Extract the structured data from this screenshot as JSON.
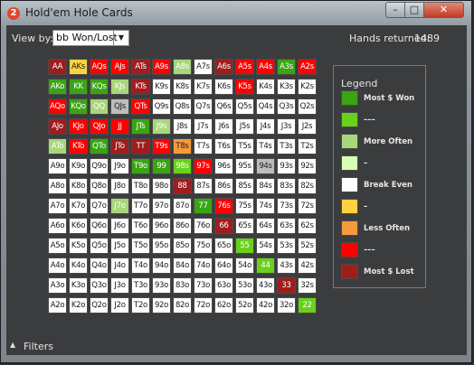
{
  "window": {
    "title": "Hold'em Hole Cards",
    "app_icon": "2",
    "controls": {
      "minimize": "–",
      "maximize": "□",
      "close": "✕"
    }
  },
  "toolbar": {
    "view_by_label": "View by:",
    "view_by_value": "bb Won/Lost",
    "dropdown_icon": "▼",
    "hands_label": "Hands returned:",
    "hands_value": "1489"
  },
  "colors": {
    "dark_red": "#9f1d1d",
    "red": "#ff0000",
    "orange": "#f79a3b",
    "yellow": "#ffd23f",
    "white": "#ffffff",
    "pale_green": "#d9ffb0",
    "light_green": "#a8d67a",
    "green": "#6ad11a",
    "dark_green": "#39a512",
    "gray": "#bdbdbd"
  },
  "grid": {
    "rows": [
      [
        "AA",
        "AKs",
        "AQs",
        "AJs",
        "ATs",
        "A9s",
        "A8s",
        "A7s",
        "A6s",
        "A5s",
        "A4s",
        "A3s",
        "A2s"
      ],
      [
        "AKo",
        "KK",
        "KQs",
        "KJs",
        "KTs",
        "K9s",
        "K8s",
        "K7s",
        "K6s",
        "K5s",
        "K4s",
        "K3s",
        "K2s"
      ],
      [
        "AQo",
        "KQo",
        "QQ",
        "QJs",
        "QTs",
        "Q9s",
        "Q8s",
        "Q7s",
        "Q6s",
        "Q5s",
        "Q4s",
        "Q3s",
        "Q2s"
      ],
      [
        "AJo",
        "KJo",
        "QJo",
        "JJ",
        "JTs",
        "J9s",
        "J8s",
        "J7s",
        "J6s",
        "J5s",
        "J4s",
        "J3s",
        "J2s"
      ],
      [
        "ATo",
        "KTo",
        "QTo",
        "JTo",
        "TT",
        "T9s",
        "T8s",
        "T7s",
        "T6s",
        "T5s",
        "T4s",
        "T3s",
        "T2s"
      ],
      [
        "A9o",
        "K9o",
        "Q9o",
        "J9o",
        "T9o",
        "99",
        "98s",
        "97s",
        "96s",
        "95s",
        "94s",
        "93s",
        "92s"
      ],
      [
        "A8o",
        "K8o",
        "Q8o",
        "J8o",
        "T8o",
        "98o",
        "88",
        "87s",
        "86s",
        "85s",
        "84s",
        "83s",
        "82s"
      ],
      [
        "A7o",
        "K7o",
        "Q7o",
        "J7o",
        "T7o",
        "97o",
        "87o",
        "77",
        "76s",
        "75s",
        "74s",
        "73s",
        "72s"
      ],
      [
        "A6o",
        "K6o",
        "Q6o",
        "J6o",
        "T6o",
        "96o",
        "86o",
        "76o",
        "66",
        "65s",
        "64s",
        "63s",
        "62s"
      ],
      [
        "A5o",
        "K5o",
        "Q5o",
        "J5o",
        "T5o",
        "95o",
        "85o",
        "75o",
        "65o",
        "55",
        "54s",
        "53s",
        "52s"
      ],
      [
        "A4o",
        "K4o",
        "Q4o",
        "J4o",
        "T4o",
        "94o",
        "84o",
        "74o",
        "64o",
        "54o",
        "44",
        "43s",
        "42s"
      ],
      [
        "A3o",
        "K3o",
        "Q3o",
        "J3o",
        "T3o",
        "93o",
        "83o",
        "73o",
        "63o",
        "53o",
        "43o",
        "33",
        "32s"
      ],
      [
        "A2o",
        "K2o",
        "Q2o",
        "J2o",
        "T2o",
        "92o",
        "82o",
        "72o",
        "62o",
        "52o",
        "42o",
        "32o",
        "22"
      ]
    ],
    "cell_colors": [
      [
        "dark_red",
        "yellow",
        "red",
        "red",
        "dark_red",
        "red",
        "light_green",
        "white",
        "dark_red",
        "red",
        "red",
        "dark_green",
        "red"
      ],
      [
        "dark_green",
        "dark_green",
        "dark_green",
        "light_green",
        "dark_red",
        "white",
        "white",
        "white",
        "white",
        "red",
        "white",
        "white",
        "white"
      ],
      [
        "red",
        "dark_green",
        "light_green",
        "gray",
        "red",
        "white",
        "white",
        "white",
        "white",
        "white",
        "white",
        "white",
        "white"
      ],
      [
        "dark_red",
        "red",
        "red",
        "red",
        "dark_green",
        "light_green",
        "white",
        "white",
        "white",
        "white",
        "white",
        "white",
        "white"
      ],
      [
        "light_green",
        "red",
        "dark_green",
        "dark_red",
        "dark_red",
        "red",
        "orange",
        "white",
        "white",
        "white",
        "white",
        "white",
        "white"
      ],
      [
        "white",
        "white",
        "white",
        "white",
        "dark_green",
        "dark_green",
        "green",
        "red",
        "white",
        "white",
        "gray",
        "white",
        "white"
      ],
      [
        "white",
        "white",
        "white",
        "white",
        "white",
        "white",
        "dark_red",
        "white",
        "white",
        "white",
        "white",
        "white",
        "white"
      ],
      [
        "white",
        "white",
        "white",
        "light_green",
        "white",
        "white",
        "white",
        "dark_green",
        "red",
        "white",
        "white",
        "white",
        "white"
      ],
      [
        "white",
        "white",
        "white",
        "white",
        "white",
        "white",
        "white",
        "white",
        "dark_red",
        "white",
        "white",
        "white",
        "white"
      ],
      [
        "white",
        "white",
        "white",
        "white",
        "white",
        "white",
        "white",
        "white",
        "white",
        "green",
        "white",
        "white",
        "white"
      ],
      [
        "white",
        "white",
        "white",
        "white",
        "white",
        "white",
        "white",
        "white",
        "white",
        "white",
        "green",
        "white",
        "white"
      ],
      [
        "white",
        "white",
        "white",
        "white",
        "white",
        "white",
        "white",
        "white",
        "white",
        "white",
        "white",
        "dark_red",
        "white"
      ],
      [
        "white",
        "white",
        "white",
        "white",
        "white",
        "white",
        "white",
        "white",
        "white",
        "white",
        "white",
        "white",
        "green"
      ]
    ]
  },
  "legend": {
    "title": "Legend",
    "items": [
      {
        "color": "dark_green",
        "label": "Most $ Won"
      },
      {
        "color": "green",
        "label": "–––"
      },
      {
        "color": "light_green",
        "label": "More Often"
      },
      {
        "color": "pale_green",
        "label": "–"
      },
      {
        "color": "white",
        "label": "Break Even"
      },
      {
        "color": "yellow",
        "label": "–"
      },
      {
        "color": "orange",
        "label": "Less Often"
      },
      {
        "color": "red",
        "label": "–––"
      },
      {
        "color": "dark_red",
        "label": "Most $ Lost"
      }
    ]
  },
  "footer": {
    "filters_icon": "▲",
    "filters_label": "Filters"
  }
}
